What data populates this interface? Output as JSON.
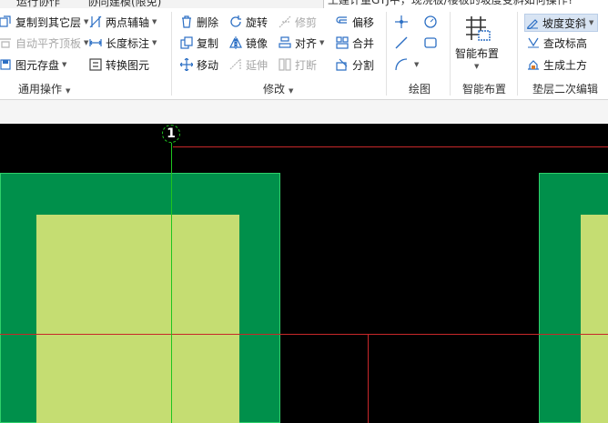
{
  "topbar": {
    "tab_collab": "运行协作",
    "tab_modeling": "协同建模(限免)",
    "search_text": "土建计量GTJ中，现浇板/楼板的坡度变斜如何操作?"
  },
  "groups": {
    "general": {
      "label": "通用操作",
      "copy_to_layer": "复制到其它层",
      "auto_flush": "自动平齐顶板",
      "save_element": "图元存盘",
      "two_point_axis": "两点辅轴",
      "length_mark": "长度标注",
      "convert_element": "转换图元"
    },
    "modify": {
      "label": "修改",
      "delete": "删除",
      "rotate": "旋转",
      "trim": "修剪",
      "offset": "偏移",
      "copy": "复制",
      "mirror": "镜像",
      "align": "对齐",
      "merge": "合并",
      "move": "移动",
      "extend": "延伸",
      "break": "打断",
      "split": "分割"
    },
    "draw": {
      "label": "绘图"
    },
    "smart": {
      "label": "智能布置",
      "button": "智能布置"
    },
    "cushion": {
      "label": "垫层二次编辑",
      "slope": "坡度变斜",
      "check_elev": "查改标高",
      "gen_earthwork": "生成土方"
    }
  },
  "canvas": {
    "axis_label": "1",
    "colors": {
      "background": "#000000",
      "outer_block": "#00904b",
      "inner_block": "#c5dd72",
      "axis_line": "#1fc51f",
      "red_line": "#c8282a"
    }
  }
}
